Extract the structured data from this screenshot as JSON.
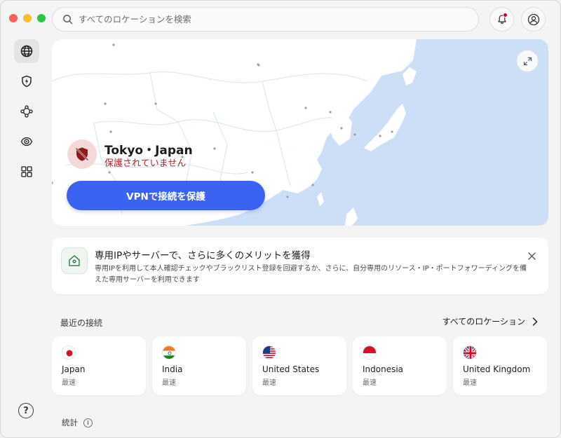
{
  "window": {
    "traffic_lights": [
      "close",
      "minimize",
      "zoom"
    ]
  },
  "search": {
    "placeholder": "すべてのロケーションを検索"
  },
  "header": {
    "notifications_icon": "bell-icon",
    "notification_dot_color": "#c4002b",
    "account_icon": "user-circle-icon"
  },
  "sidebar": {
    "items": [
      {
        "icon": "globe-icon",
        "active": true
      },
      {
        "icon": "shield-bolt-icon",
        "active": false
      },
      {
        "icon": "network-nodes-icon",
        "active": false
      },
      {
        "icon": "eye-target-icon",
        "active": false
      },
      {
        "icon": "grid-apps-icon",
        "active": false
      }
    ],
    "help_label": "?"
  },
  "map": {
    "location": "Tokyo・Japan",
    "status": "保護されていません",
    "status_color": "#b7222a",
    "connect_label": "VPNで接続を保護",
    "connect_color": "#3b63f2",
    "expand_icon": "expand-arrows-icon"
  },
  "promo": {
    "title": "専用IPやサーバーで、さらに多くのメリットを獲得",
    "description": "専用IPを利用して本人確認チェックやブラックリスト登録を回避するか、さらに、自分専用のリソース・IP・ポートフォワーディングを備えた専用サーバーを利用できます",
    "icon": "house-pin-icon",
    "close_icon": "close-icon"
  },
  "recent": {
    "title": "最近の接続",
    "all_locations": "すべてのロケーション",
    "items": [
      {
        "country": "Japan",
        "subtitle": "最速",
        "flag": "jp"
      },
      {
        "country": "India",
        "subtitle": "最速",
        "flag": "in"
      },
      {
        "country": "United States",
        "subtitle": "最速",
        "flag": "us"
      },
      {
        "country": "Indonesia",
        "subtitle": "最速",
        "flag": "id"
      },
      {
        "country": "United Kingdom",
        "subtitle": "最速",
        "flag": "gb"
      }
    ]
  },
  "stats": {
    "title": "統計",
    "info_label": "i"
  }
}
